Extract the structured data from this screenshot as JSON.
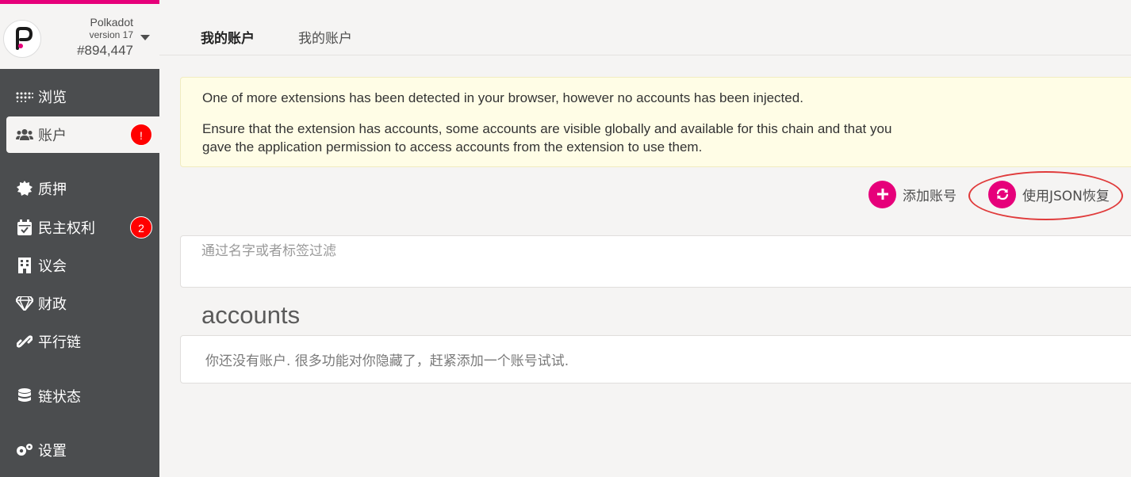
{
  "chain": {
    "name": "Polkadot",
    "version": "version 17",
    "block": "#894,447"
  },
  "sidebar": {
    "items": [
      {
        "label": "浏览",
        "icon": "dots-grid-icon"
      },
      {
        "label": "账户",
        "icon": "users-icon",
        "badge": "!",
        "active": true
      },
      {
        "label": "质押",
        "icon": "certificate-icon"
      },
      {
        "label": "民主权利",
        "icon": "calendar-check-icon",
        "badge": "2"
      },
      {
        "label": "议会",
        "icon": "building-icon"
      },
      {
        "label": "财政",
        "icon": "gem-icon"
      },
      {
        "label": "平行链",
        "icon": "link-icon"
      },
      {
        "label": "链状态",
        "icon": "database-icon"
      },
      {
        "label": "设置",
        "icon": "cogs-icon"
      }
    ]
  },
  "tabs": [
    {
      "label": "我的账户",
      "active": true
    },
    {
      "label": "我的账户",
      "active": false
    }
  ],
  "banner": {
    "line1": "One of more extensions has been detected in your browser, however no accounts has been injected.",
    "line2": "Ensure that the extension has accounts, some accounts are visible globally and available for this chain and that you gave the application permission to access accounts from the extension to use them."
  },
  "actions": {
    "add_label": "添加账号",
    "restore_label": "使用JSON恢复"
  },
  "filter": {
    "placeholder": "通过名字或者标签过滤",
    "value": ""
  },
  "accounts": {
    "title": "accounts",
    "empty_message": "你还没有账户. 很多功能对你隐藏了，赶紧添加一个账号试试."
  },
  "colors": {
    "accent": "#e6007a",
    "sidebar_bg": "#4b4d4f",
    "badge": "#ff0000",
    "highlight_ring": "#e03b3b",
    "banner_bg": "#fffde6"
  }
}
